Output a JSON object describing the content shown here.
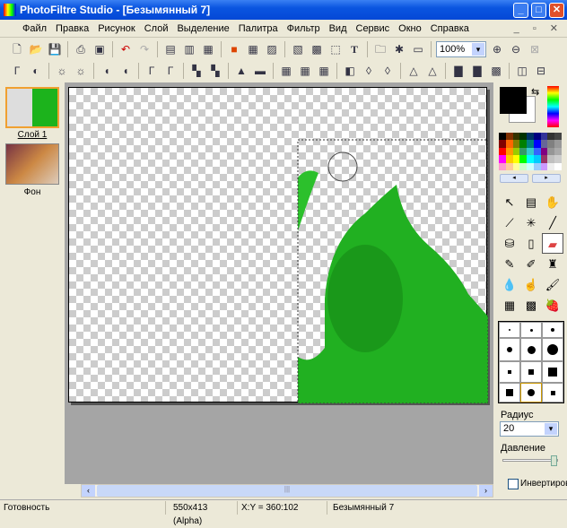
{
  "window": {
    "title": "PhotoFiltre Studio - [Безымянный 7]"
  },
  "menu": [
    "Файл",
    "Правка",
    "Рисунок",
    "Слой",
    "Выделение",
    "Палитра",
    "Фильтр",
    "Вид",
    "Сервис",
    "Окно",
    "Справка"
  ],
  "toolbar": {
    "zoom": "100%"
  },
  "layers": [
    {
      "name": "Слой 1"
    },
    {
      "name": "Фон"
    }
  ],
  "right_panel": {
    "radius_label": "Радиус",
    "radius_value": "20",
    "pressure_label": "Давление",
    "pressure_level": 0.95,
    "invert_label": "Инвертировать",
    "invert_checked": false,
    "foreground": "#000000",
    "background": "#ffffff"
  },
  "status": {
    "state": "Готовность",
    "size": "550x413 (Alpha)",
    "coords": "X:Y = 360:102",
    "doc": "Безымянный 7"
  }
}
